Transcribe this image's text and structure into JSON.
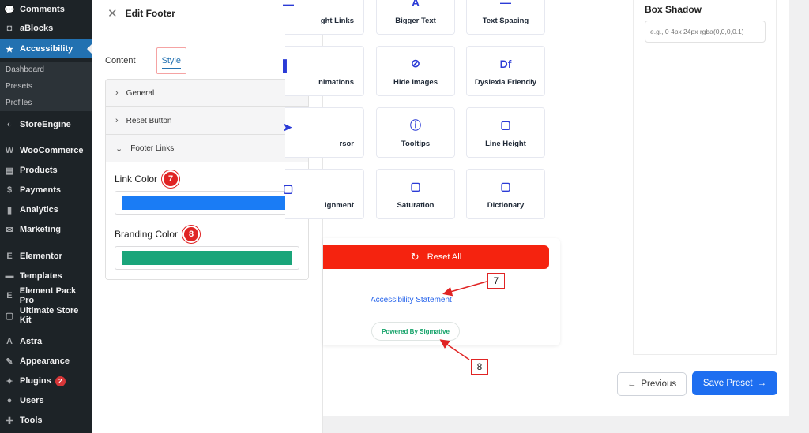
{
  "wp_sidebar": {
    "items_top": [
      {
        "label": "Comments",
        "icon": "comments-icon",
        "glyph": "💬"
      },
      {
        "label": "aBlocks",
        "icon": "ablocks-icon",
        "glyph": "◘"
      },
      {
        "label": "Accessibility",
        "icon": "star-icon",
        "glyph": "★"
      }
    ],
    "submenu": [
      "Dashboard",
      "Presets",
      "Profiles"
    ],
    "items_bottom": [
      {
        "label": "StoreEngine",
        "icon": "storeengine-icon",
        "glyph": "◐"
      },
      {
        "label": "WooCommerce",
        "icon": "woocommerce-icon",
        "glyph": "W"
      },
      {
        "label": "Products",
        "icon": "products-icon",
        "glyph": "▤"
      },
      {
        "label": "Payments",
        "icon": "payments-icon",
        "glyph": "$"
      },
      {
        "label": "Analytics",
        "icon": "analytics-icon",
        "glyph": "▮"
      },
      {
        "label": "Marketing",
        "icon": "marketing-icon",
        "glyph": "✉"
      },
      {
        "label": "Elementor",
        "icon": "elementor-icon",
        "glyph": "E"
      },
      {
        "label": "Templates",
        "icon": "templates-icon",
        "glyph": "▬"
      },
      {
        "label": "Element Pack Pro",
        "icon": "element-pack-icon",
        "glyph": "E"
      },
      {
        "label": "Ultimate Store Kit",
        "icon": "store-kit-icon",
        "glyph": "▢"
      },
      {
        "label": "Astra",
        "icon": "astra-icon",
        "glyph": "A"
      },
      {
        "label": "Appearance",
        "icon": "appearance-icon",
        "glyph": "✎"
      },
      {
        "label": "Plugins",
        "icon": "plugins-icon",
        "glyph": "✦",
        "badge": "2"
      },
      {
        "label": "Users",
        "icon": "users-icon",
        "glyph": "●"
      },
      {
        "label": "Tools",
        "icon": "tools-icon",
        "glyph": "✚"
      }
    ]
  },
  "editor": {
    "title": "Edit Footer",
    "tabs": [
      "Content",
      "Style"
    ],
    "sections": [
      "General",
      "Reset Button",
      "Footer Links"
    ],
    "link_color_label": "Link Color",
    "link_color_value": "#1a7cf5",
    "branding_color_label": "Branding Color",
    "branding_color_value": "#1aa57a",
    "callout_1": "7",
    "callout_2": "8"
  },
  "tiles": [
    {
      "label": "ght Links",
      "icon": "links-icon",
      "glyph": "—"
    },
    {
      "label": "Bigger Text",
      "icon": "bigger-text-icon",
      "glyph": "A"
    },
    {
      "label": "Text Spacing",
      "icon": "text-spacing-icon",
      "glyph": "—"
    },
    {
      "label": "nimations",
      "icon": "animations-icon",
      "glyph": "▌"
    },
    {
      "label": "Hide Images",
      "icon": "hide-images-icon",
      "glyph": "⊘"
    },
    {
      "label": "Dyslexia Friendly",
      "icon": "dyslexia-icon",
      "glyph": "Df"
    },
    {
      "label": "rsor",
      "icon": "cursor-icon",
      "glyph": "➤"
    },
    {
      "label": "Tooltips",
      "icon": "tooltips-icon",
      "glyph": "ⓘ"
    },
    {
      "label": "Line Height",
      "icon": "line-height-icon",
      "glyph": "▢"
    },
    {
      "label": "ignment",
      "icon": "alignment-icon",
      "glyph": "▢"
    },
    {
      "label": "Saturation",
      "icon": "saturation-icon",
      "glyph": "▢"
    },
    {
      "label": "Dictionary",
      "icon": "dictionary-icon",
      "glyph": "▢"
    }
  ],
  "footer": {
    "reset_label": "Reset All",
    "statement_link": "Accessibility Statement",
    "powered_by": "Powered By Sigmative",
    "annotation_7": "7",
    "annotation_8": "8"
  },
  "right_panel": {
    "box_shadow_label": "Box Shadow",
    "box_shadow_placeholder": "e.g., 0 4px 24px rgba(0,0,0,0.1)"
  },
  "nav": {
    "previous_label": "Previous",
    "save_label": "Save Preset"
  }
}
